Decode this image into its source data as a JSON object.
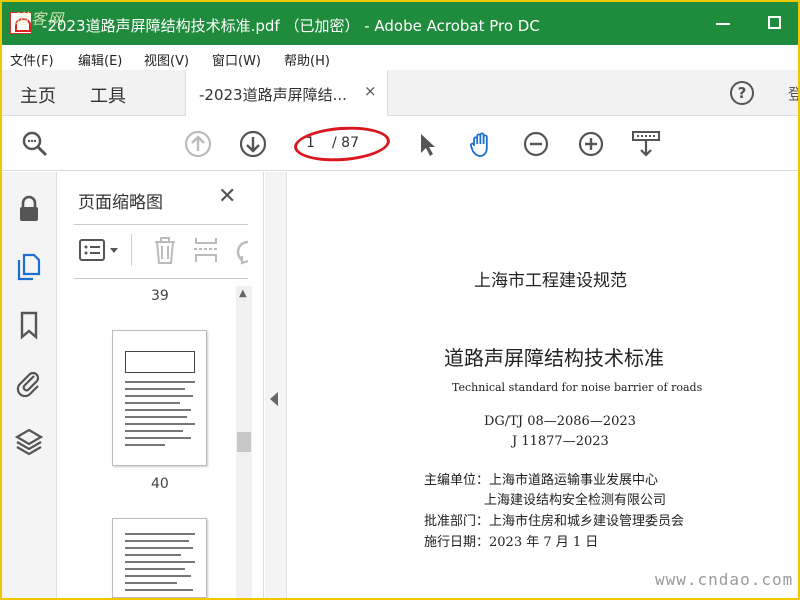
{
  "titlebar": {
    "watermark": "道客网",
    "title": "-2023道路声屏障结构技术标准.pdf （已加密） - Adobe Acrobat Pro DC",
    "minimize_label": "—",
    "maximize_label": "□"
  },
  "menubar": {
    "items": [
      "文件(F)",
      "编辑(E)",
      "视图(V)",
      "窗口(W)",
      "帮助(H)"
    ]
  },
  "tabs": {
    "home": "主页",
    "tools": "工具",
    "document_tab": "-2023道路声屏障结...",
    "close_glyph": "×",
    "help_glyph": "?",
    "sign_in_stub": "登"
  },
  "toolbar": {
    "current_page": "1",
    "total_pages": "/ 87",
    "icons": [
      "search-icon",
      "page-up-icon",
      "page-down-icon",
      "select-arrow-icon",
      "hand-tool-icon",
      "zoom-out-icon",
      "zoom-in-icon",
      "keyboard-download-icon"
    ],
    "accent": "#1a6fd1",
    "annotation_color": "#d9171f"
  },
  "leftstrip": {
    "icons": [
      "lock-icon",
      "page-thumbnails-icon",
      "bookmark-icon",
      "attachment-icon",
      "layers-icon"
    ]
  },
  "thumbnails": {
    "title": "页面缩略图",
    "close_glyph": "✕",
    "page_labels": [
      "39",
      "40"
    ]
  },
  "document": {
    "spec_name": "上海市工程建设规范",
    "title": "道路声屏障结构技术标准",
    "english_title": "Technical standard for noise barrier of roads",
    "code1": "DG/TJ 08—2086—2023",
    "code2": "J 11877—2023",
    "chief_unit_line1": "主编单位：上海市道路运输事业发展中心",
    "chief_unit_line2": "上海建设结构安全检测有限公司",
    "approval": "批准部门：上海市住房和城乡建设管理委员会",
    "effective_date": "施行日期：2023 年 7 月 1 日"
  },
  "site_watermark": "www.cndao.com",
  "colors": {
    "titlebar_bg": "#1f8b3c",
    "frame_border": "#f0c800"
  }
}
